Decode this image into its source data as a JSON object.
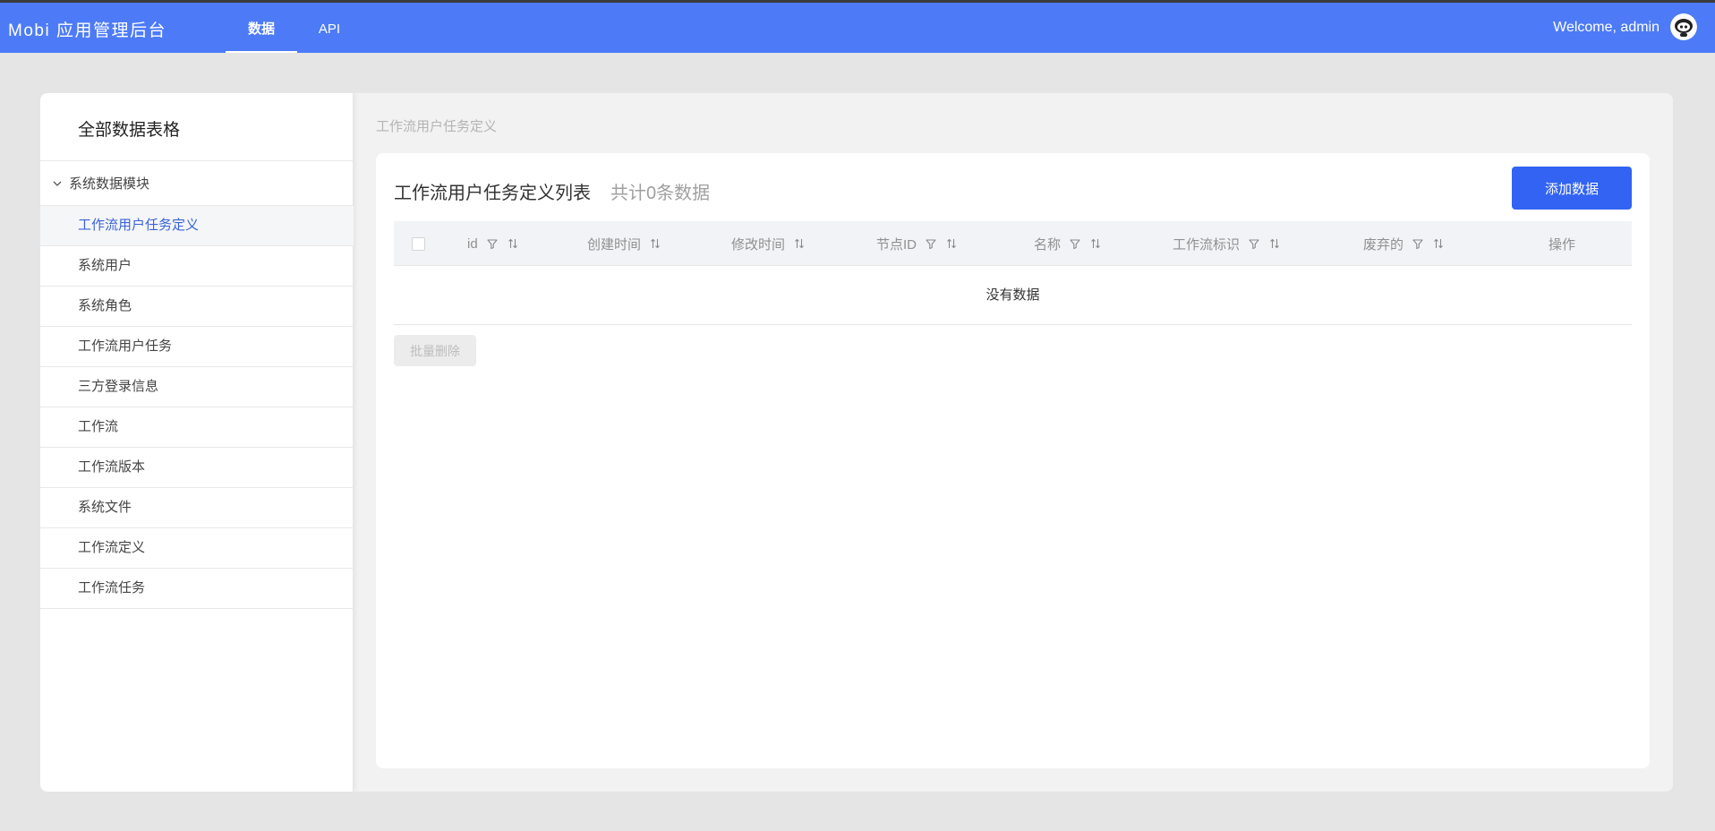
{
  "navbar": {
    "brand": "Mobi 应用管理后台",
    "tabs": [
      {
        "label": "数据",
        "active": true
      },
      {
        "label": "API",
        "active": false
      }
    ],
    "welcome": "Welcome, admin",
    "bg_color": "#4d7bf7"
  },
  "sidebar": {
    "title": "全部数据表格",
    "group_label": "系统数据模块",
    "items": [
      {
        "label": "工作流用户任务定义",
        "active": true
      },
      {
        "label": "系统用户"
      },
      {
        "label": "系统角色"
      },
      {
        "label": "工作流用户任务"
      },
      {
        "label": "三方登录信息"
      },
      {
        "label": "工作流"
      },
      {
        "label": "工作流版本"
      },
      {
        "label": "系统文件"
      },
      {
        "label": "工作流定义"
      },
      {
        "label": "工作流任务"
      }
    ],
    "active_color": "#3a63d6"
  },
  "main": {
    "breadcrumb": "工作流用户任务定义",
    "title": "工作流用户任务定义列表",
    "count": "共计0条数据",
    "add_button": "添加数据",
    "columns": [
      {
        "label": "id",
        "filter": true,
        "sort": true
      },
      {
        "label": "创建时间",
        "filter": false,
        "sort": true
      },
      {
        "label": "修改时间",
        "filter": false,
        "sort": true
      },
      {
        "label": "节点ID",
        "filter": true,
        "sort": true
      },
      {
        "label": "名称",
        "filter": true,
        "sort": true
      },
      {
        "label": "工作流标识",
        "filter": true,
        "sort": true
      },
      {
        "label": "废弃的",
        "filter": true,
        "sort": true
      },
      {
        "label": "操作",
        "filter": false,
        "sort": false
      }
    ],
    "empty_text": "没有数据",
    "batch_delete": "批量删除",
    "primary_color": "#3263f3"
  }
}
